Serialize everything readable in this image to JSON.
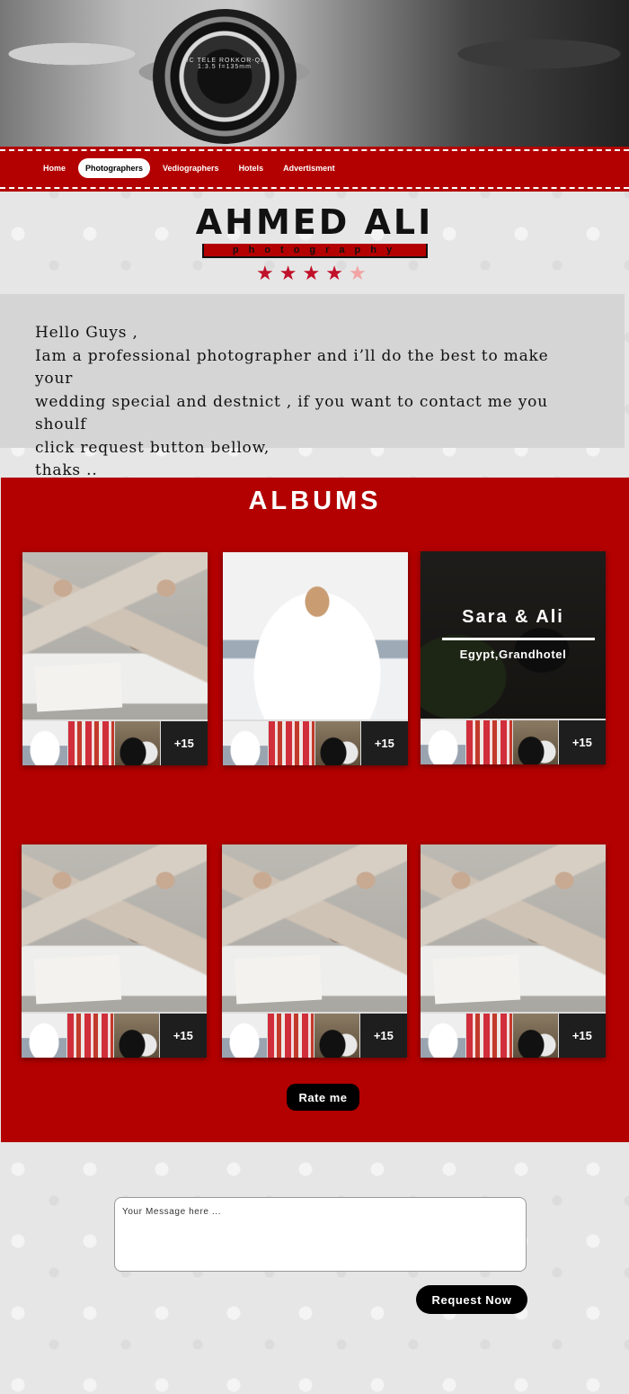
{
  "hero": {
    "lens_text": "MC TELE ROKKOR-QD 1:3.5 f=135mm"
  },
  "nav": {
    "items": [
      {
        "label": "Home"
      },
      {
        "label": "Photographers",
        "active": true
      },
      {
        "label": "Vediographers"
      },
      {
        "label": "Hotels"
      },
      {
        "label": "Advertisment"
      }
    ]
  },
  "profile": {
    "name": "AHMED ALI",
    "tagline": "photography",
    "rating": 4,
    "rating_max": 5
  },
  "intro": {
    "lines": [
      "Hello Guys ,",
      "Iam a professional photographer and i’ll do the best to make your",
      "wedding special and destnict , if you want to contact me you shoulf",
      "click request button bellow,",
      "thaks .."
    ]
  },
  "albums": {
    "title": "ALBUMS",
    "items": [
      {
        "cover": "shoes",
        "more": "+15"
      },
      {
        "cover": "bride",
        "more": "+15"
      },
      {
        "cover": "couple",
        "more": "+15",
        "hover_title": "Sara & Ali",
        "hover_subtitle": "Egypt,Grandhotel"
      },
      {
        "cover": "shoes",
        "more": "+15"
      },
      {
        "cover": "shoes",
        "more": "+15"
      },
      {
        "cover": "shoes",
        "more": "+15"
      }
    ],
    "rate_label": "Rate me"
  },
  "contact": {
    "placeholder": "Your Message here ...",
    "request_label": "Request Now"
  },
  "colors": {
    "accent": "#b30000",
    "star": "#c0102a",
    "star_faded": "#f2a3a3"
  }
}
